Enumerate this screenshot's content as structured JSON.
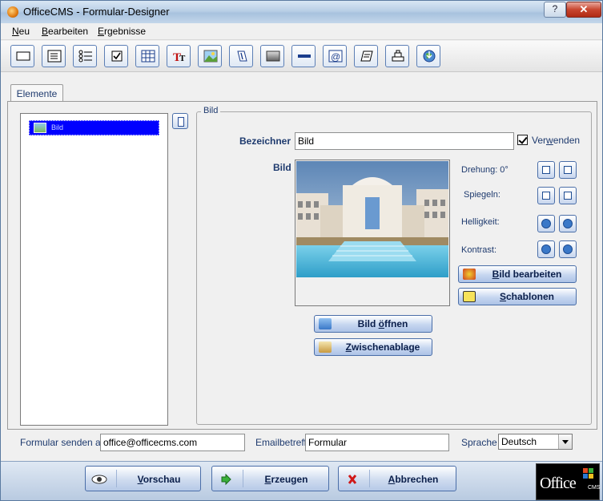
{
  "window": {
    "title": "OfficeCMS - Formular-Designer",
    "help_label": "?",
    "close_label": "✕"
  },
  "menu": [
    {
      "label": "Neu",
      "underline": "N",
      "rest": "eu"
    },
    {
      "label": "Bearbeiten",
      "underline": "B",
      "rest": "earbeiten"
    },
    {
      "label": "Ergebnisse",
      "underline": "E",
      "rest": "rgebnisse"
    }
  ],
  "toolbar": {
    "buttons": [
      "textbox-icon",
      "textarea-icon",
      "list-icon",
      "checkbox-icon",
      "table-icon",
      "title-text-icon",
      "image-icon",
      "attachment-icon",
      "gradient-box-icon",
      "separator-icon",
      "email-icon",
      "page-icon",
      "layers-icon",
      "globe-icon"
    ]
  },
  "tabs": [
    {
      "label": "Elemente"
    }
  ],
  "elements_list": [
    {
      "label": "Bild",
      "selected": true
    }
  ],
  "group": {
    "legend": "Bild",
    "name_label": "Bezeichner",
    "name_value": "Bild",
    "use_label_pre": "Ver",
    "use_label_u": "w",
    "use_label_post": "enden",
    "use_checked": true,
    "image_label": "Bild",
    "rotation_label": "Drehung: 0°",
    "mirror_label": "Spiegeln:",
    "brightness_label": "Helligkeit:",
    "contrast_label": "Kontrast:",
    "edit_button_u": "B",
    "edit_button_rest": "ild bearbeiten",
    "templates_button_u": "S",
    "templates_button_rest": "chablonen",
    "open_button_pre": "Bild ",
    "open_button_u": "ö",
    "open_button_rest": "ffnen",
    "clipboard_button_u": "Z",
    "clipboard_button_rest": "wischenablage"
  },
  "footer": {
    "send_to_label": "Formular senden an",
    "send_to_value": "office@officecms.com",
    "subject_label": "Emailbetreff",
    "subject_value": "Formular",
    "language_label": "Sprache",
    "language_value": "Deutsch"
  },
  "actions": {
    "preview_u": "V",
    "preview_rest": "orschau",
    "generate_u": "E",
    "generate_rest": "rzeugen",
    "cancel_u": "A",
    "cancel_rest": "bbrechen"
  },
  "logo": {
    "text": "Office",
    "sub": "CMS"
  },
  "colors": {
    "accent": "#1e3a6e",
    "selection": "#0000ff",
    "close_button": "#c8452f"
  }
}
